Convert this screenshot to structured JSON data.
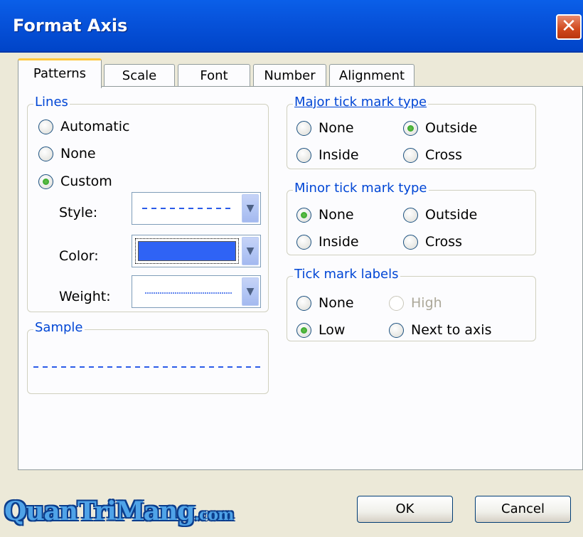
{
  "window": {
    "title": "Format Axis",
    "close_symbol": "✕"
  },
  "tabs": [
    {
      "label": "Patterns",
      "active": true
    },
    {
      "label": "Scale",
      "active": false
    },
    {
      "label": "Font",
      "active": false
    },
    {
      "label": "Number",
      "active": false
    },
    {
      "label": "Alignment",
      "active": false
    }
  ],
  "lines": {
    "legend": "Lines",
    "options": [
      {
        "label": "Automatic",
        "checked": false
      },
      {
        "label": "None",
        "checked": false
      },
      {
        "label": "Custom",
        "checked": true
      }
    ],
    "style_label": "Style:",
    "color_label": "Color:",
    "weight_label": "Weight:",
    "color_value": "#2F63F5",
    "line_color": "#2B5BE8"
  },
  "sample": {
    "legend": "Sample"
  },
  "major_tick": {
    "legend": "Major tick mark type",
    "options": [
      {
        "label": "None",
        "checked": false
      },
      {
        "label": "Outside",
        "checked": true
      },
      {
        "label": "Inside",
        "checked": false
      },
      {
        "label": "Cross",
        "checked": false
      }
    ]
  },
  "minor_tick": {
    "legend": "Minor tick mark type",
    "options": [
      {
        "label": "None",
        "checked": true
      },
      {
        "label": "Outside",
        "checked": false
      },
      {
        "label": "Inside",
        "checked": false
      },
      {
        "label": "Cross",
        "checked": false
      }
    ]
  },
  "tick_labels": {
    "legend": "Tick mark labels",
    "options": [
      {
        "label": "None",
        "checked": false
      },
      {
        "label": "High",
        "checked": false,
        "disabled": true
      },
      {
        "label": "Low",
        "checked": true
      },
      {
        "label": "Next to axis",
        "checked": false
      }
    ]
  },
  "buttons": {
    "ok": "OK",
    "cancel": "Cancel"
  },
  "watermark": {
    "main": "QuanTriMang",
    "suffix": ".com"
  }
}
